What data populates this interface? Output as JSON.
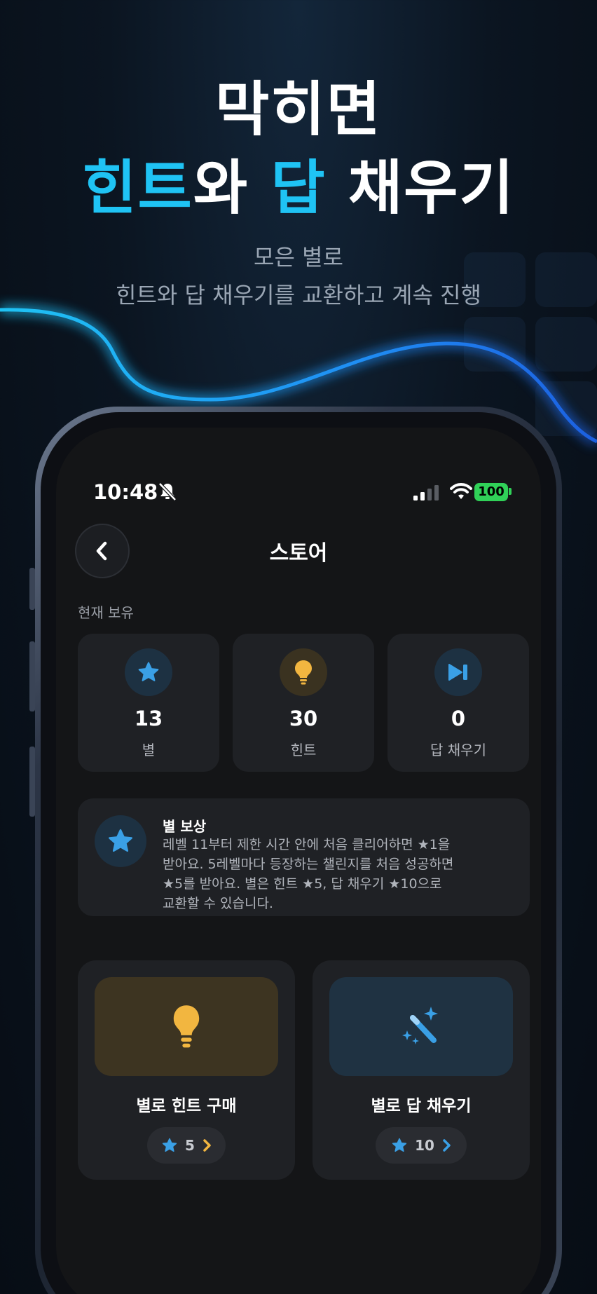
{
  "headline": {
    "line1": "막히면",
    "accent1": "힌트",
    "join1": "와 ",
    "accent2": "답",
    "rest": " 채우기"
  },
  "subtitle": {
    "line1": "모은 별로",
    "line2": "힌트와 답 채우기를 교환하고 계속 진행"
  },
  "status_bar": {
    "time": "10:48",
    "battery": "100"
  },
  "header": {
    "title": "스토어"
  },
  "holdings": {
    "label": "현재 보유",
    "items": [
      {
        "value": "13",
        "label": "별",
        "icon": "star-icon"
      },
      {
        "value": "30",
        "label": "힌트",
        "icon": "lightbulb-icon"
      },
      {
        "value": "0",
        "label": "답 채우기",
        "icon": "skip-forward-icon"
      }
    ]
  },
  "reward_info": {
    "title": "별 보상",
    "line1": "레벨 11부터 제한 시간 안에 처음 클리어하면 ★1을",
    "line2": "받아요. 5레벨마다 등장하는 챌린지를 처음 성공하면",
    "line3": "★5를 받아요. 별은 힌트 ★5, 답 채우기 ★10으로",
    "line4": "교환할 수 있습니다."
  },
  "store_items": [
    {
      "name": "별로 힌트 구매",
      "price": "5",
      "icon": "lightbulb-icon"
    },
    {
      "name": "별로 답 채우기",
      "price": "10",
      "icon": "magic-wand-icon"
    }
  ],
  "colors": {
    "accent": "#1fc3f4",
    "star": "#3aa0e6",
    "bulb": "#f2b640",
    "chevron_gold": "#f2b640",
    "chevron_blue": "#3aa0e6",
    "battery": "#30d158"
  }
}
